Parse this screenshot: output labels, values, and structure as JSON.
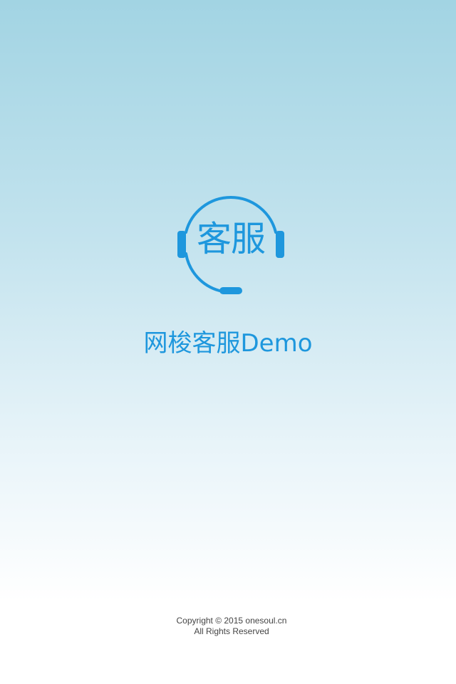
{
  "logo": {
    "text": "客服",
    "icon": "headset-icon",
    "color": "#1e97dd"
  },
  "app_title": "网梭客服Demo",
  "footer": {
    "copyright": "Copyright © 2015 onesoul.cn",
    "rights": "All Rights Reserved"
  },
  "colors": {
    "accent": "#1e97dd",
    "background_top": "#a2d4e3",
    "background_bottom": "#ffffff"
  }
}
